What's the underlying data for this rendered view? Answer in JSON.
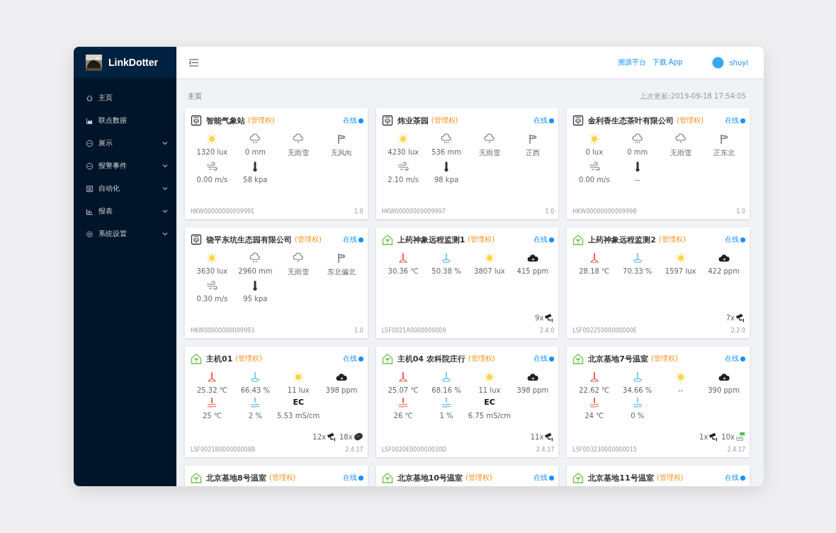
{
  "sidebar": {
    "brand": "LinkDotter",
    "items": [
      {
        "kind": "home",
        "label": "主页"
      },
      {
        "kind": "data",
        "label": "联点数据"
      },
      {
        "kind": "display",
        "label": "展示"
      },
      {
        "kind": "alarm",
        "label": "报警事件"
      },
      {
        "kind": "automation",
        "label": "自动化"
      },
      {
        "kind": "report",
        "label": "报表"
      },
      {
        "kind": "settings",
        "label": "系统设置"
      }
    ]
  },
  "header": {
    "links": [
      "溯源平台",
      "下载 App"
    ],
    "user": "shuyi"
  },
  "breadcrumb": "主页",
  "updated": "上次更新:2019-09-18 17:54:05",
  "devices": [
    {
      "kind": "station",
      "title": "智能气象站",
      "role": "(管理权)",
      "status": "在线",
      "online": true,
      "readings": [
        {
          "kind": "sun",
          "text": "1320 lux"
        },
        {
          "kind": "rain",
          "text": "0 mm"
        },
        {
          "kind": "snow",
          "text": "无雨雪"
        },
        {
          "kind": "windsock",
          "text": "无风向"
        },
        {
          "kind": "wind",
          "text": "0.00 m/s"
        },
        {
          "kind": "pressure",
          "text": "58 kpa"
        }
      ],
      "id": "HKW00000000009991",
      "version": "1.0"
    },
    {
      "kind": "station",
      "title": "炜业茶园",
      "role": "(管理权)",
      "status": "在线",
      "online": true,
      "readings": [
        {
          "kind": "sun",
          "text": "4230 lux"
        },
        {
          "kind": "rain",
          "text": "536 mm"
        },
        {
          "kind": "snow",
          "text": "无雨雪"
        },
        {
          "kind": "windsock",
          "text": "正西"
        },
        {
          "kind": "wind",
          "text": "2.10 m/s"
        },
        {
          "kind": "pressure",
          "text": "98 kpa"
        }
      ],
      "id": "HKW00000000009997",
      "version": "1.0"
    },
    {
      "kind": "station",
      "title": "金利香生态茶叶有限公司",
      "role": "(管理权)",
      "status": "在线",
      "online": true,
      "readings": [
        {
          "kind": "sun",
          "text": "0 lux"
        },
        {
          "kind": "rain",
          "text": "0 mm"
        },
        {
          "kind": "snow",
          "text": "无雨雪"
        },
        {
          "kind": "windsock",
          "text": "正东北"
        },
        {
          "kind": "wind",
          "text": "0.00 m/s"
        },
        {
          "kind": "pressure",
          "text": "--"
        }
      ],
      "id": "HKW00000000009998",
      "version": "1.0"
    },
    {
      "kind": "station",
      "title": "饶平东坑生态园有限公司",
      "role": "(管理权)",
      "status": "在线",
      "online": true,
      "readings": [
        {
          "kind": "sun",
          "text": "3630 lux"
        },
        {
          "kind": "rain",
          "text": "2960 mm"
        },
        {
          "kind": "snow",
          "text": "无雨雪"
        },
        {
          "kind": "windsock",
          "text": "东北偏北"
        },
        {
          "kind": "wind",
          "text": "0.30 m/s"
        },
        {
          "kind": "pressure",
          "text": "95 kpa"
        }
      ],
      "id": "HKW00000000009993",
      "version": "1.0"
    },
    {
      "kind": "greenhouse",
      "title": "上药神象远程监测1",
      "role": "(管理权)",
      "status": "在线",
      "online": true,
      "readings": [
        {
          "kind": "air-temp",
          "text": "30.36 ℃"
        },
        {
          "kind": "air-hum",
          "text": "50.38 %"
        },
        {
          "kind": "sun",
          "text": "3807 lux"
        },
        {
          "kind": "co2",
          "text": "415 ppm"
        }
      ],
      "badges": [
        {
          "count": "9x",
          "kind": "camera"
        }
      ],
      "id": "LSF0021A0000000009",
      "version": "2.4.0"
    },
    {
      "kind": "greenhouse",
      "title": "上药神象远程监测2",
      "role": "(管理权)",
      "status": "在线",
      "online": true,
      "readings": [
        {
          "kind": "air-temp",
          "text": "28.18 ℃"
        },
        {
          "kind": "air-hum",
          "text": "70.33 %"
        },
        {
          "kind": "sun",
          "text": "1597 lux"
        },
        {
          "kind": "co2",
          "text": "422 ppm"
        }
      ],
      "badges": [
        {
          "count": "7x",
          "kind": "camera"
        }
      ],
      "id": "LSF00225000000000E",
      "version": "2.2.0"
    },
    {
      "kind": "greenhouse",
      "title": "主机01",
      "role": "(管理权)",
      "status": "在线",
      "online": true,
      "readings": [
        {
          "kind": "air-temp",
          "text": "25.32 ℃"
        },
        {
          "kind": "air-hum",
          "text": "66.43 %"
        },
        {
          "kind": "sun",
          "text": "11 lux"
        },
        {
          "kind": "co2",
          "text": "398 ppm"
        },
        {
          "kind": "soil-temp",
          "text": "25 ℃"
        },
        {
          "kind": "soil-hum",
          "text": "2 %"
        },
        {
          "kind": "ec",
          "label": "EC",
          "text": "5.53 mS/cm"
        }
      ],
      "badges": [
        {
          "count": "12x",
          "kind": "camera"
        },
        {
          "count": "18x",
          "kind": "chip"
        }
      ],
      "id": "LSF0021B000000008B",
      "version": "2.4.17"
    },
    {
      "kind": "greenhouse",
      "title": "主机04 农科院庄行",
      "role": "(管理权)",
      "status": "在线",
      "online": true,
      "readings": [
        {
          "kind": "air-temp",
          "text": "25.07 ℃"
        },
        {
          "kind": "air-hum",
          "text": "68.16 %"
        },
        {
          "kind": "sun",
          "text": "11 lux"
        },
        {
          "kind": "co2",
          "text": "398 ppm"
        },
        {
          "kind": "soil-temp",
          "text": "26 ℃"
        },
        {
          "kind": "soil-hum",
          "text": "1 %"
        },
        {
          "kind": "ec",
          "label": "EC",
          "text": "6.75 mS/cm"
        }
      ],
      "badges": [
        {
          "count": "11x",
          "kind": "camera"
        }
      ],
      "id": "LSF0020E000000030D",
      "version": "2.4.17"
    },
    {
      "kind": "greenhouse",
      "title": "北京基地7号温室",
      "role": "(管理权)",
      "status": "在线",
      "online": true,
      "readings": [
        {
          "kind": "air-temp",
          "text": "22.62 ℃"
        },
        {
          "kind": "air-hum",
          "text": "34.66 %"
        },
        {
          "kind": "sun",
          "text": "--"
        },
        {
          "kind": "co2",
          "text": "390 ppm"
        },
        {
          "kind": "soil-temp",
          "text": "24 ℃"
        },
        {
          "kind": "soil-hum",
          "text": "0 %"
        }
      ],
      "badges": [
        {
          "count": "1x",
          "kind": "camera"
        },
        {
          "count": "10x",
          "kind": "sensor"
        }
      ],
      "id": "LSF003230000000015",
      "version": "2.4.17"
    },
    {
      "kind": "greenhouse",
      "title": "北京基地8号温室",
      "role": "(管理权)",
      "status": "在线",
      "online": true
    },
    {
      "kind": "greenhouse",
      "title": "北京基地10号温室",
      "role": "(管理权)",
      "status": "在线",
      "online": true
    },
    {
      "kind": "greenhouse",
      "title": "北京基地11号温室",
      "role": "(管理权)",
      "status": "在线",
      "online": true
    }
  ]
}
